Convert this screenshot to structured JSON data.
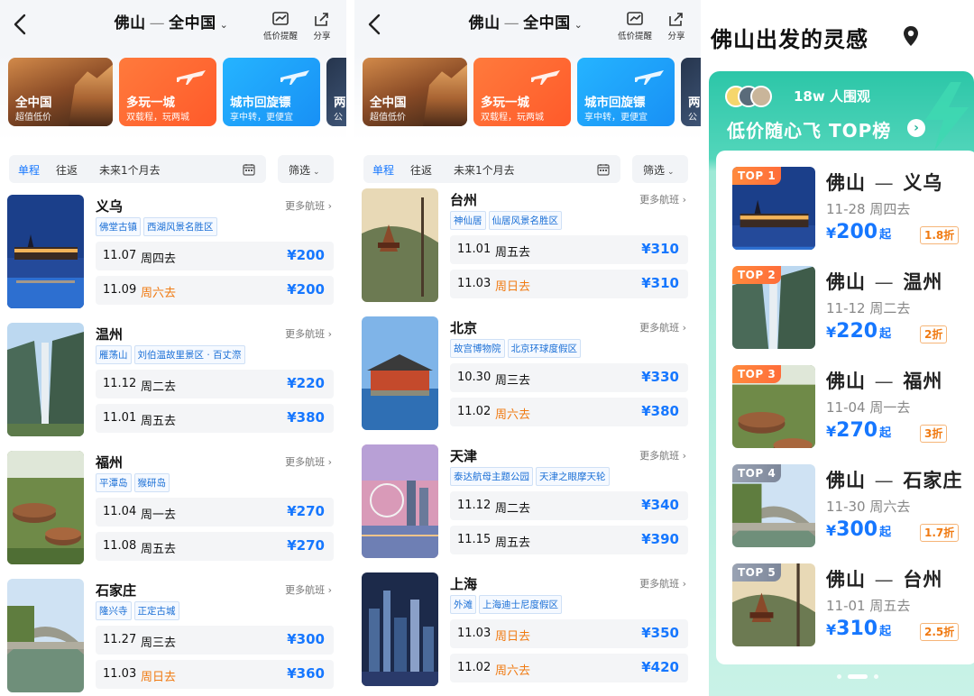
{
  "header": {
    "origin": "佛山",
    "dest": "全中国",
    "price_alert_label": "低价提醒",
    "share_label": "分享"
  },
  "promos": [
    {
      "title": "全中国",
      "subtitle": "超值低价"
    },
    {
      "title": "多玩一城",
      "subtitle": "双载程，玩两城"
    },
    {
      "title": "城市回旋镖",
      "subtitle": "享中转，更便宜"
    },
    {
      "title": "两",
      "subtitle": "公"
    }
  ],
  "filterbar": {
    "tab_oneway": "单程",
    "tab_round": "往返",
    "range": "未来1个月去",
    "filter_label": "筛选"
  },
  "more_flights_label": "更多航班",
  "list_a": [
    {
      "city": "义乌",
      "tags": [
        "佛堂古镇",
        "西湖风景名胜区"
      ],
      "flights": [
        {
          "date": "11.07",
          "weekday": "周四去",
          "price": "¥200",
          "weekend": false
        },
        {
          "date": "11.09",
          "weekday": "周六去",
          "price": "¥200",
          "weekend": true
        }
      ]
    },
    {
      "city": "温州",
      "tags": [
        "雁荡山",
        "刘伯温故里景区 · 百丈漈"
      ],
      "flights": [
        {
          "date": "11.12",
          "weekday": "周二去",
          "price": "¥220",
          "weekend": false
        },
        {
          "date": "11.01",
          "weekday": "周五去",
          "price": "¥380",
          "weekend": false
        }
      ]
    },
    {
      "city": "福州",
      "tags": [
        "平潭岛",
        "猴研岛"
      ],
      "flights": [
        {
          "date": "11.04",
          "weekday": "周一去",
          "price": "¥270",
          "weekend": false
        },
        {
          "date": "11.08",
          "weekday": "周五去",
          "price": "¥270",
          "weekend": false
        }
      ]
    },
    {
      "city": "石家庄",
      "tags": [
        "隆兴寺",
        "正定古城"
      ],
      "flights": [
        {
          "date": "11.27",
          "weekday": "周三去",
          "price": "¥300",
          "weekend": false
        },
        {
          "date": "11.03",
          "weekday": "周日去",
          "price": "¥360",
          "weekend": true
        }
      ]
    }
  ],
  "list_b": [
    {
      "city": "台州",
      "tags": [
        "神仙居",
        "仙居风景名胜区"
      ],
      "flights": [
        {
          "date": "11.01",
          "weekday": "周五去",
          "price": "¥310",
          "weekend": false
        },
        {
          "date": "11.03",
          "weekday": "周日去",
          "price": "¥310",
          "weekend": true
        }
      ]
    },
    {
      "city": "北京",
      "tags": [
        "故宫博物院",
        "北京环球度假区"
      ],
      "flights": [
        {
          "date": "10.30",
          "weekday": "周三去",
          "price": "¥330",
          "weekend": false
        },
        {
          "date": "11.02",
          "weekday": "周六去",
          "price": "¥380",
          "weekend": true
        }
      ]
    },
    {
      "city": "天津",
      "tags": [
        "泰达航母主题公园",
        "天津之眼摩天轮"
      ],
      "flights": [
        {
          "date": "11.12",
          "weekday": "周二去",
          "price": "¥340",
          "weekend": false
        },
        {
          "date": "11.15",
          "weekday": "周五去",
          "price": "¥390",
          "weekend": false
        }
      ]
    },
    {
      "city": "上海",
      "tags": [
        "外滩",
        "上海迪士尼度假区"
      ],
      "flights": [
        {
          "date": "11.03",
          "weekday": "周日去",
          "price": "¥350",
          "weekend": true
        },
        {
          "date": "11.02",
          "weekday": "周六去",
          "price": "¥420",
          "weekend": true
        }
      ]
    }
  ],
  "inspiration": {
    "title": "佛山出发的灵感",
    "watchers": "18w 人围观",
    "rank_title": "低价随心飞 TOP榜",
    "price_suffix": "起",
    "items": [
      {
        "rank": "TOP 1",
        "origin": "佛山",
        "dest": "义乌",
        "date": "11-28 周四去",
        "price": "200",
        "discount": "1.8折"
      },
      {
        "rank": "TOP 2",
        "origin": "佛山",
        "dest": "温州",
        "date": "11-12 周二去",
        "price": "220",
        "discount": "2折"
      },
      {
        "rank": "TOP 3",
        "origin": "佛山",
        "dest": "福州",
        "date": "11-04 周一去",
        "price": "270",
        "discount": "3折"
      },
      {
        "rank": "TOP 4",
        "origin": "佛山",
        "dest": "石家庄",
        "date": "11-30 周六去",
        "price": "300",
        "discount": "1.7折"
      },
      {
        "rank": "TOP 5",
        "origin": "佛山",
        "dest": "台州",
        "date": "11-01 周五去",
        "price": "310",
        "discount": "2.5折"
      }
    ]
  },
  "colors": {
    "accent": "#1677ff",
    "weekend": "#f07a12",
    "promo_orange": "#ff6a2f",
    "promo_blue": "#1f9cfa",
    "teal": "#2cc6a8"
  }
}
